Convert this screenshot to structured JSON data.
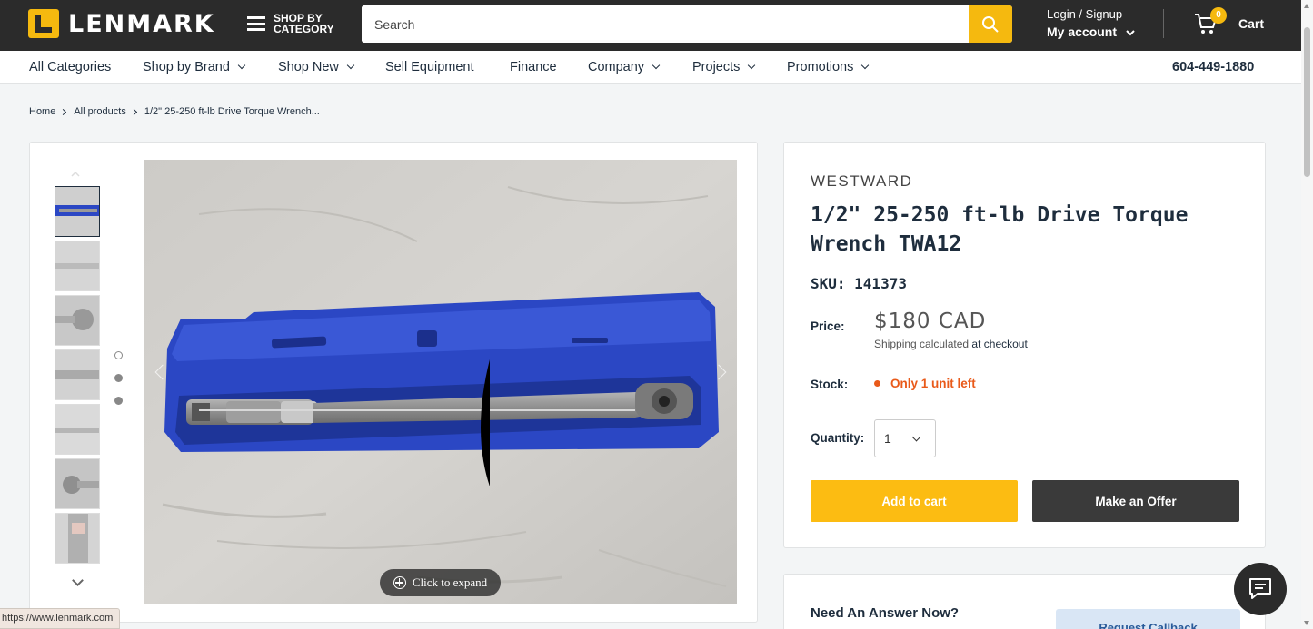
{
  "header": {
    "logo_text": "LENMARK",
    "shop_by_category": "SHOP BY CATEGORY",
    "search_placeholder": "Search",
    "login_signup": "Login / Signup",
    "my_account": "My account",
    "cart_count": "0",
    "cart_label": "Cart"
  },
  "nav": {
    "items": [
      {
        "label": "All Categories",
        "dropdown": false
      },
      {
        "label": "Shop by Brand",
        "dropdown": true
      },
      {
        "label": "Shop New",
        "dropdown": true
      },
      {
        "label": "Sell Equipment",
        "dropdown": false
      },
      {
        "label": "Finance",
        "dropdown": false
      },
      {
        "label": "Company",
        "dropdown": true
      },
      {
        "label": "Projects",
        "dropdown": true
      },
      {
        "label": "Promotions",
        "dropdown": true
      }
    ],
    "phone": "604-449-1880"
  },
  "breadcrumb": [
    "Home",
    "All products",
    "1/2\" 25-250 ft-lb Drive Torque Wrench..."
  ],
  "gallery": {
    "thumbnail_count": 7,
    "expand_label": "Click to expand"
  },
  "product": {
    "brand": "WESTWARD",
    "title": "1/2\" 25-250 ft-lb Drive Torque Wrench TWA12",
    "sku": "SKU: 141373",
    "price_label": "Price:",
    "price": "$180 CAD",
    "shipping_text": "Shipping calculated",
    "shipping_link": "at checkout",
    "stock_label": "Stock:",
    "stock_value": "Only 1 unit left",
    "quantity_label": "Quantity:",
    "quantity_value": "1",
    "add_to_cart": "Add to cart",
    "make_offer": "Make an Offer"
  },
  "answer": {
    "heading": "Need An Answer Now?",
    "callback": "Request Callback"
  },
  "status_url": "https://www.lenmark.com",
  "colors": {
    "header_bg": "#2b2b2b",
    "accent": "#f5b90f",
    "stock": "#e95a1a",
    "case_blue": "#2b47c4"
  },
  "icons": [
    "search-icon",
    "cart-icon",
    "chevron-down-icon",
    "chat-icon",
    "expand-icon"
  ]
}
